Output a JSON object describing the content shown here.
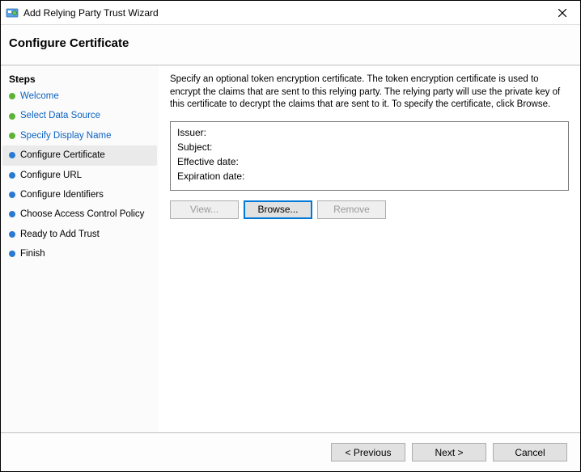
{
  "window": {
    "title": "Add Relying Party Trust Wizard"
  },
  "page": {
    "heading": "Configure Certificate",
    "steps_label": "Steps"
  },
  "sidebar": {
    "items": [
      {
        "label": "Welcome",
        "status": "done",
        "link": true
      },
      {
        "label": "Select Data Source",
        "status": "done",
        "link": true
      },
      {
        "label": "Specify Display Name",
        "status": "done",
        "link": true
      },
      {
        "label": "Configure Certificate",
        "status": "current",
        "link": false
      },
      {
        "label": "Configure URL",
        "status": "future",
        "link": false
      },
      {
        "label": "Configure Identifiers",
        "status": "future",
        "link": false
      },
      {
        "label": "Choose Access Control Policy",
        "status": "future",
        "link": false
      },
      {
        "label": "Ready to Add Trust",
        "status": "future",
        "link": false
      },
      {
        "label": "Finish",
        "status": "future",
        "link": false
      }
    ]
  },
  "content": {
    "description": "Specify an optional token encryption certificate.  The token encryption certificate is used to encrypt the claims that are sent to this relying party.  The relying party will use the private key of this certificate to decrypt the claims that are sent to it.  To specify the certificate, click Browse.",
    "cert": {
      "issuer_label": "Issuer:",
      "subject_label": "Subject:",
      "effective_label": "Effective date:",
      "expiration_label": "Expiration date:",
      "issuer_value": "",
      "subject_value": "",
      "effective_value": "",
      "expiration_value": ""
    },
    "buttons": {
      "view": "View...",
      "browse": "Browse...",
      "remove": "Remove"
    }
  },
  "footer": {
    "previous": "< Previous",
    "next": "Next >",
    "cancel": "Cancel"
  }
}
